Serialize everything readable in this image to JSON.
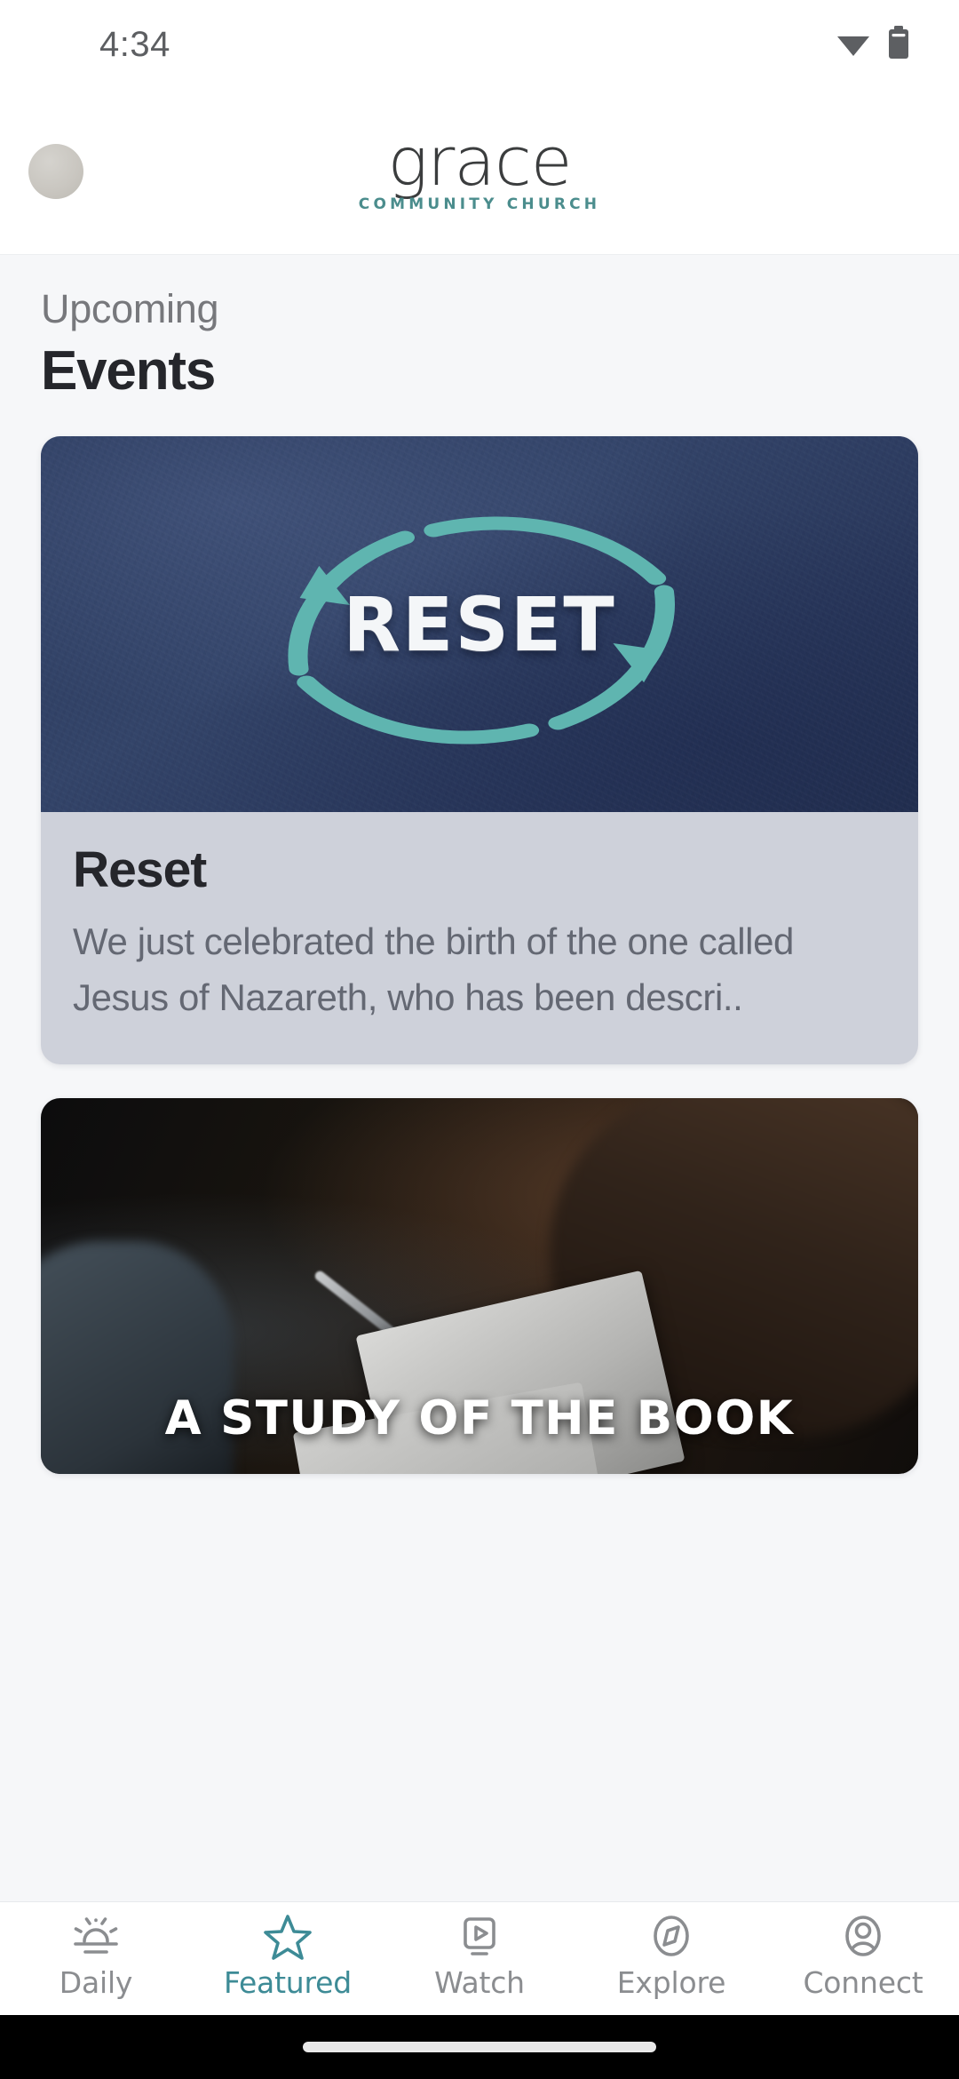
{
  "status_bar": {
    "time": "4:34",
    "wifi_icon": "wifi-icon",
    "battery_icon": "battery-icon"
  },
  "header": {
    "avatar": "user-avatar",
    "brand_word": "grace",
    "brand_subtitle": "COMMUNITY CHURCH",
    "brand_color": "#3b3d3e",
    "brand_accent_color": "#4b8d8d"
  },
  "section": {
    "eyebrow": "Upcoming",
    "title": "Events"
  },
  "cards": [
    {
      "hero_type": "reset-artwork",
      "hero_text": "RESET",
      "hero_bg_color": "#2f3f63",
      "hero_accent_color": "#5fb5b0",
      "title": "Reset",
      "description": "We just celebrated the birth of the one called Jesus of Nazareth, who has been descri.."
    },
    {
      "hero_type": "study-photo",
      "hero_text": "A STUDY OF THE BOOK",
      "title": "",
      "description": ""
    }
  ],
  "tabbar": {
    "items": [
      {
        "label": "Daily",
        "icon": "sunrise-icon",
        "active": false
      },
      {
        "label": "Featured",
        "icon": "star-icon",
        "active": true
      },
      {
        "label": "Watch",
        "icon": "video-icon",
        "active": false
      },
      {
        "label": "Explore",
        "icon": "compass-icon",
        "active": false
      },
      {
        "label": "Connect",
        "icon": "person-icon",
        "active": false
      }
    ],
    "active_color": "#3d8b96",
    "inactive_color": "#8b8d90"
  },
  "gesture_bar": {
    "handle": "home-indicator"
  }
}
